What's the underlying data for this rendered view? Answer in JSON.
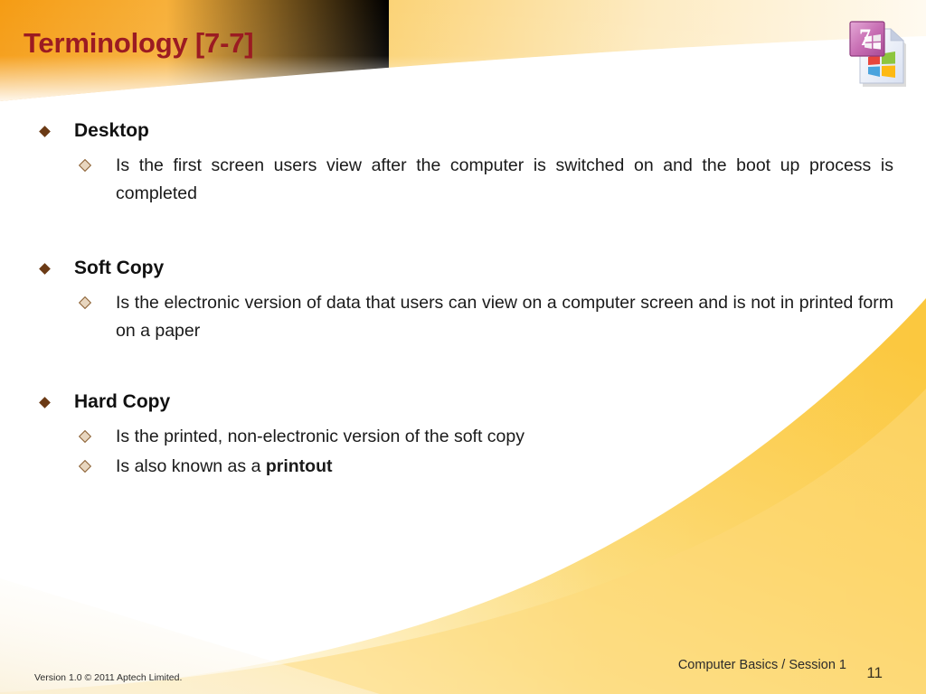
{
  "slide": {
    "title": "Terminology [7-7]",
    "title_color": "#9b1b22",
    "background_color": "#ffffff",
    "header_gradient_from": "#f5a21e",
    "header_gradient_to": "#fffdf5",
    "swoosh_color": "#fcd462",
    "bullet1_color": "#6b3a15",
    "bullet2_color": "#8a6034"
  },
  "logo": {
    "name": "windows-7-document-icon",
    "badge_text": "7"
  },
  "content": {
    "groups": [
      {
        "heading": "Desktop",
        "items": [
          {
            "text": "Is the first screen users view after the computer is switched on and the boot up process is completed",
            "justified": true,
            "bold_tail": ""
          }
        ]
      },
      {
        "heading": "Soft Copy",
        "items": [
          {
            "text": "Is the electronic version of data that users can view on a computer screen and is not in printed form on a paper",
            "justified": true,
            "bold_tail": ""
          }
        ]
      },
      {
        "heading": "Hard Copy",
        "items": [
          {
            "text": "Is the printed, non-electronic version of the soft copy",
            "justified": false,
            "bold_tail": ""
          },
          {
            "text": "Is also known as a ",
            "justified": false,
            "bold_tail": "printout"
          }
        ]
      }
    ]
  },
  "footer": {
    "version_text": "Version 1.0 © 2011 Aptech Limited.",
    "course_text": "Computer Basics / Session 1",
    "page_number": "11"
  }
}
